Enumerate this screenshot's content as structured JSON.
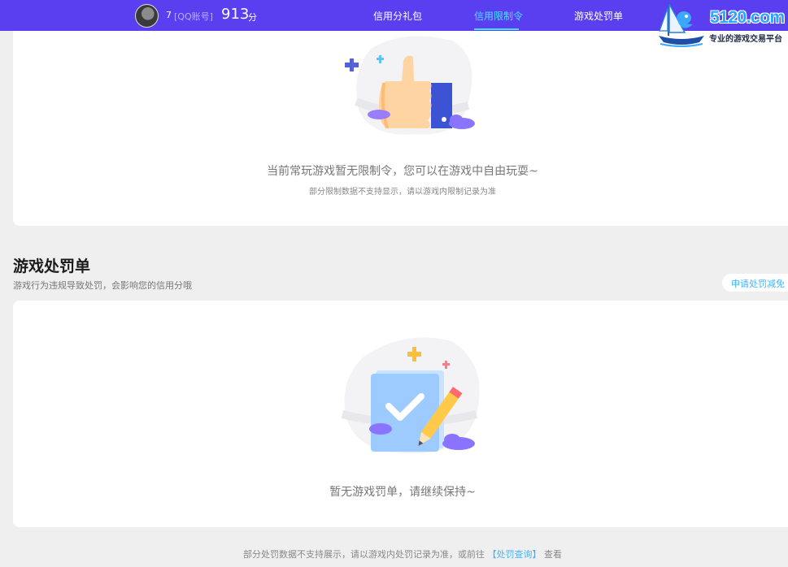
{
  "header": {
    "user_id": "7",
    "account_type": "[QQ账号]",
    "score": "913",
    "score_unit": "分",
    "tabs": [
      {
        "label": "信用分礼包",
        "active": false
      },
      {
        "label": "信用限制令",
        "active": true
      },
      {
        "label": "游戏处罚单",
        "active": false
      }
    ],
    "accent_color": "#5a3ff0",
    "active_tab_color": "#48e0ff"
  },
  "brand": {
    "name": "5120.com",
    "slogan": "专业的游戏交易平台",
    "icon": "sailboat-dolphin-logo"
  },
  "restriction_card": {
    "icon": "thumbs-up-illustration",
    "message": "当前常玩游戏暂无限制令，您可以在游戏中自由玩耍~",
    "note": "部分限制数据不支持显示，请以游戏内限制记录为准"
  },
  "penalty_section": {
    "title": "游戏处罚单",
    "subtitle": "游戏行为违规导致处罚，会影响您的信用分哦",
    "appeal_button": "申请处罚减免",
    "icon": "checklist-pencil-illustration",
    "empty_message": "暂无游戏罚单，请继续保持~"
  },
  "footer": {
    "note_prefix": "部分处罚数据不支持展示，请以游戏内处罚记录为准，或前往",
    "link": "【处罚查询】",
    "note_suffix": "查看"
  }
}
